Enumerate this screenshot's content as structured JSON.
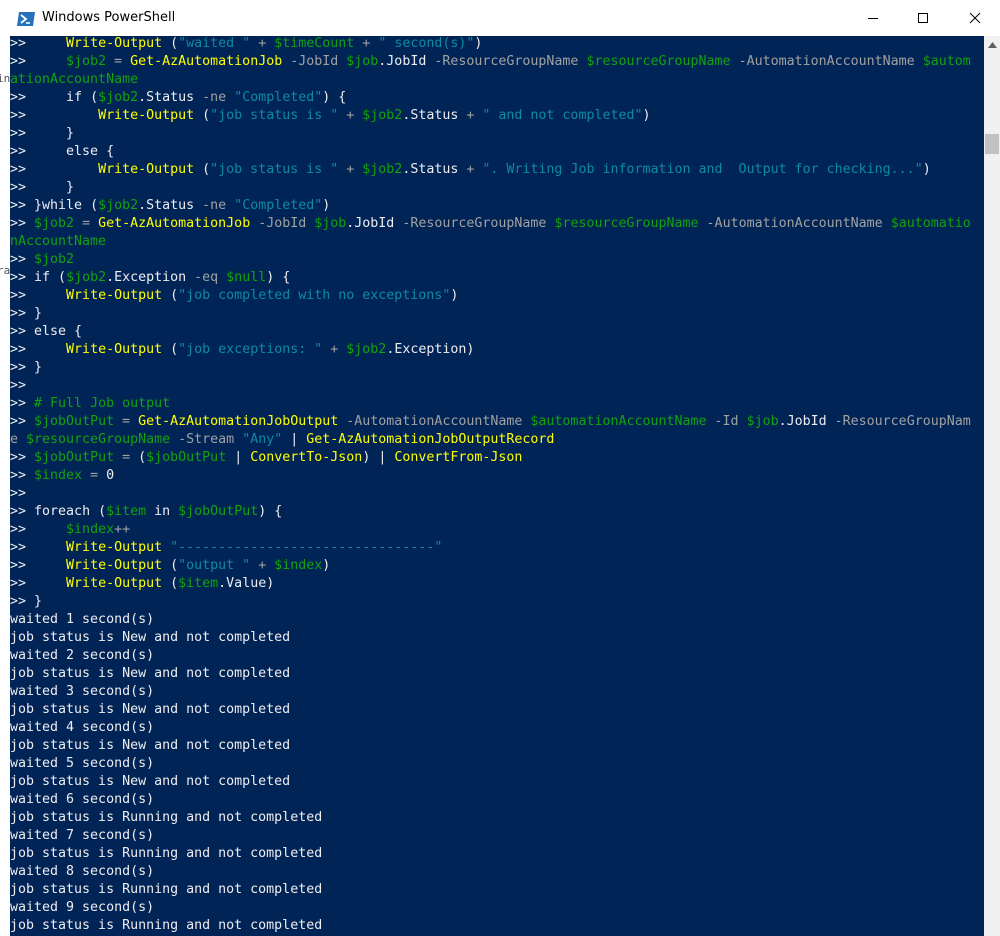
{
  "window": {
    "title": "Windows PowerShell",
    "icon": "powershell-icon",
    "controls": [
      "minimize-icon",
      "maximize-icon",
      "close-icon"
    ]
  },
  "colors": {
    "console_bg": "#012456",
    "default_text": "#eeedf0",
    "command": "#ffff00",
    "variable": "#13a10e",
    "string": "#0e8a9e",
    "operator": "#a1a1a1"
  },
  "left_strip_fragments": [
    "in",
    "ra"
  ],
  "console_lines": [
    [
      [
        ">>     ",
        "def"
      ],
      [
        "Write-Output",
        "cmd"
      ],
      [
        " (",
        "def"
      ],
      [
        "\"waited \"",
        "str"
      ],
      [
        " + ",
        "op"
      ],
      [
        "$timeCount",
        "var"
      ],
      [
        " + ",
        "op"
      ],
      [
        "\" second(s)\"",
        "str"
      ],
      [
        ")",
        "def"
      ]
    ],
    [
      [
        ">>     ",
        "def"
      ],
      [
        "$job2",
        "var"
      ],
      [
        " = ",
        "op"
      ],
      [
        "Get-AzAutomationJob",
        "cmd"
      ],
      [
        " -JobId ",
        "op"
      ],
      [
        "$job",
        "var"
      ],
      [
        ".JobId ",
        "def"
      ],
      [
        "-ResourceGroupName ",
        "op"
      ],
      [
        "$resourceGroupName",
        "var"
      ],
      [
        " -AutomationAccountName ",
        "op"
      ],
      [
        "$autom",
        "var"
      ]
    ],
    [
      [
        "ationAccountName",
        "var"
      ]
    ],
    [
      [
        ">>     ",
        "def"
      ],
      [
        "if (",
        "def"
      ],
      [
        "$job2",
        "var"
      ],
      [
        ".Status ",
        "def"
      ],
      [
        "-ne ",
        "op"
      ],
      [
        "\"Completed\"",
        "str"
      ],
      [
        ") {",
        "def"
      ]
    ],
    [
      [
        ">>         ",
        "def"
      ],
      [
        "Write-Output",
        "cmd"
      ],
      [
        " (",
        "def"
      ],
      [
        "\"job status is \"",
        "str"
      ],
      [
        " + ",
        "op"
      ],
      [
        "$job2",
        "var"
      ],
      [
        ".Status ",
        "def"
      ],
      [
        "+ ",
        "op"
      ],
      [
        "\" and not completed\"",
        "str"
      ],
      [
        ")",
        "def"
      ]
    ],
    [
      [
        ">>     }",
        "def"
      ]
    ],
    [
      [
        ">>     else {",
        "def"
      ]
    ],
    [
      [
        ">>         ",
        "def"
      ],
      [
        "Write-Output",
        "cmd"
      ],
      [
        " (",
        "def"
      ],
      [
        "\"job status is \"",
        "str"
      ],
      [
        " + ",
        "op"
      ],
      [
        "$job2",
        "var"
      ],
      [
        ".Status ",
        "def"
      ],
      [
        "+ ",
        "op"
      ],
      [
        "\". Writing Job information and  Output for checking...\"",
        "str"
      ],
      [
        ")",
        "def"
      ]
    ],
    [
      [
        ">>     }",
        "def"
      ]
    ],
    [
      [
        ">> }",
        "def"
      ],
      [
        "while (",
        "def"
      ],
      [
        "$job2",
        "var"
      ],
      [
        ".Status ",
        "def"
      ],
      [
        "-ne ",
        "op"
      ],
      [
        "\"Completed\"",
        "str"
      ],
      [
        ")",
        "def"
      ]
    ],
    [
      [
        ">> ",
        "def"
      ],
      [
        "$job2",
        "var"
      ],
      [
        " = ",
        "op"
      ],
      [
        "Get-AzAutomationJob",
        "cmd"
      ],
      [
        " -JobId ",
        "op"
      ],
      [
        "$job",
        "var"
      ],
      [
        ".JobId ",
        "def"
      ],
      [
        "-ResourceGroupName ",
        "op"
      ],
      [
        "$resourceGroupName",
        "var"
      ],
      [
        " -AutomationAccountName ",
        "op"
      ],
      [
        "$automatio",
        "var"
      ]
    ],
    [
      [
        "nAccountName",
        "var"
      ]
    ],
    [
      [
        ">> ",
        "def"
      ],
      [
        "$job2",
        "var"
      ]
    ],
    [
      [
        ">> ",
        "def"
      ],
      [
        "if (",
        "def"
      ],
      [
        "$job2",
        "var"
      ],
      [
        ".Exception ",
        "def"
      ],
      [
        "-eq ",
        "op"
      ],
      [
        "$null",
        "var"
      ],
      [
        ") {",
        "def"
      ]
    ],
    [
      [
        ">>     ",
        "def"
      ],
      [
        "Write-Output",
        "cmd"
      ],
      [
        " (",
        "def"
      ],
      [
        "\"job completed with no exceptions\"",
        "str"
      ],
      [
        ")",
        "def"
      ]
    ],
    [
      [
        ">> }",
        "def"
      ]
    ],
    [
      [
        ">> else {",
        "def"
      ]
    ],
    [
      [
        ">>     ",
        "def"
      ],
      [
        "Write-Output",
        "cmd"
      ],
      [
        " (",
        "def"
      ],
      [
        "\"job exceptions: \"",
        "str"
      ],
      [
        " + ",
        "op"
      ],
      [
        "$job2",
        "var"
      ],
      [
        ".Exception)",
        "def"
      ]
    ],
    [
      [
        ">> }",
        "def"
      ]
    ],
    [
      [
        ">>",
        "def"
      ]
    ],
    [
      [
        ">> ",
        "def"
      ],
      [
        "# Full Job output",
        "cmt"
      ]
    ],
    [
      [
        ">> ",
        "def"
      ],
      [
        "$jobOutPut",
        "var"
      ],
      [
        " = ",
        "op"
      ],
      [
        "Get-AzAutomationJobOutput",
        "cmd"
      ],
      [
        " -AutomationAccountName ",
        "op"
      ],
      [
        "$automationAccountName",
        "var"
      ],
      [
        " -Id ",
        "op"
      ],
      [
        "$job",
        "var"
      ],
      [
        ".JobId ",
        "def"
      ],
      [
        "-ResourceGroupNam",
        "op"
      ]
    ],
    [
      [
        "e ",
        "op"
      ],
      [
        "$resourceGroupName",
        "var"
      ],
      [
        " -Stream ",
        "op"
      ],
      [
        "\"Any\"",
        "str"
      ],
      [
        " | ",
        "def"
      ],
      [
        "Get-AzAutomationJobOutputRecord",
        "cmd"
      ]
    ],
    [
      [
        ">> ",
        "def"
      ],
      [
        "$jobOutPut",
        "var"
      ],
      [
        " = ",
        "op"
      ],
      [
        "(",
        "def"
      ],
      [
        "$jobOutPut",
        "var"
      ],
      [
        " | ",
        "def"
      ],
      [
        "ConvertTo-Json",
        "cmd"
      ],
      [
        ") | ",
        "def"
      ],
      [
        "ConvertFrom-Json",
        "cmd"
      ]
    ],
    [
      [
        ">> ",
        "def"
      ],
      [
        "$index",
        "var"
      ],
      [
        " = ",
        "op"
      ],
      [
        "0",
        "def"
      ]
    ],
    [
      [
        ">>",
        "def"
      ]
    ],
    [
      [
        ">> ",
        "def"
      ],
      [
        "foreach (",
        "def"
      ],
      [
        "$item",
        "var"
      ],
      [
        " in ",
        "def"
      ],
      [
        "$jobOutPut",
        "var"
      ],
      [
        ") {",
        "def"
      ]
    ],
    [
      [
        ">>     ",
        "def"
      ],
      [
        "$index",
        "var"
      ],
      [
        "++",
        "op"
      ]
    ],
    [
      [
        ">>     ",
        "def"
      ],
      [
        "Write-Output",
        "cmd"
      ],
      [
        " ",
        "def"
      ],
      [
        "\"--------------------------------\"",
        "str"
      ]
    ],
    [
      [
        ">>     ",
        "def"
      ],
      [
        "Write-Output",
        "cmd"
      ],
      [
        " (",
        "def"
      ],
      [
        "\"output \"",
        "str"
      ],
      [
        " + ",
        "op"
      ],
      [
        "$index",
        "var"
      ],
      [
        ")",
        "def"
      ]
    ],
    [
      [
        ">>     ",
        "def"
      ],
      [
        "Write-Output",
        "cmd"
      ],
      [
        " (",
        "def"
      ],
      [
        "$item",
        "var"
      ],
      [
        ".Value)",
        "def"
      ]
    ],
    [
      [
        ">> }",
        "def"
      ]
    ],
    [
      [
        "waited 1 second(s)",
        "def"
      ]
    ],
    [
      [
        "job status is New and not completed",
        "def"
      ]
    ],
    [
      [
        "waited 2 second(s)",
        "def"
      ]
    ],
    [
      [
        "job status is New and not completed",
        "def"
      ]
    ],
    [
      [
        "waited 3 second(s)",
        "def"
      ]
    ],
    [
      [
        "job status is New and not completed",
        "def"
      ]
    ],
    [
      [
        "waited 4 second(s)",
        "def"
      ]
    ],
    [
      [
        "job status is New and not completed",
        "def"
      ]
    ],
    [
      [
        "waited 5 second(s)",
        "def"
      ]
    ],
    [
      [
        "job status is New and not completed",
        "def"
      ]
    ],
    [
      [
        "waited 6 second(s)",
        "def"
      ]
    ],
    [
      [
        "job status is Running and not completed",
        "def"
      ]
    ],
    [
      [
        "waited 7 second(s)",
        "def"
      ]
    ],
    [
      [
        "job status is Running and not completed",
        "def"
      ]
    ],
    [
      [
        "waited 8 second(s)",
        "def"
      ]
    ],
    [
      [
        "job status is Running and not completed",
        "def"
      ]
    ],
    [
      [
        "waited 9 second(s)",
        "def"
      ]
    ],
    [
      [
        "job status is Running and not completed",
        "def"
      ]
    ]
  ]
}
